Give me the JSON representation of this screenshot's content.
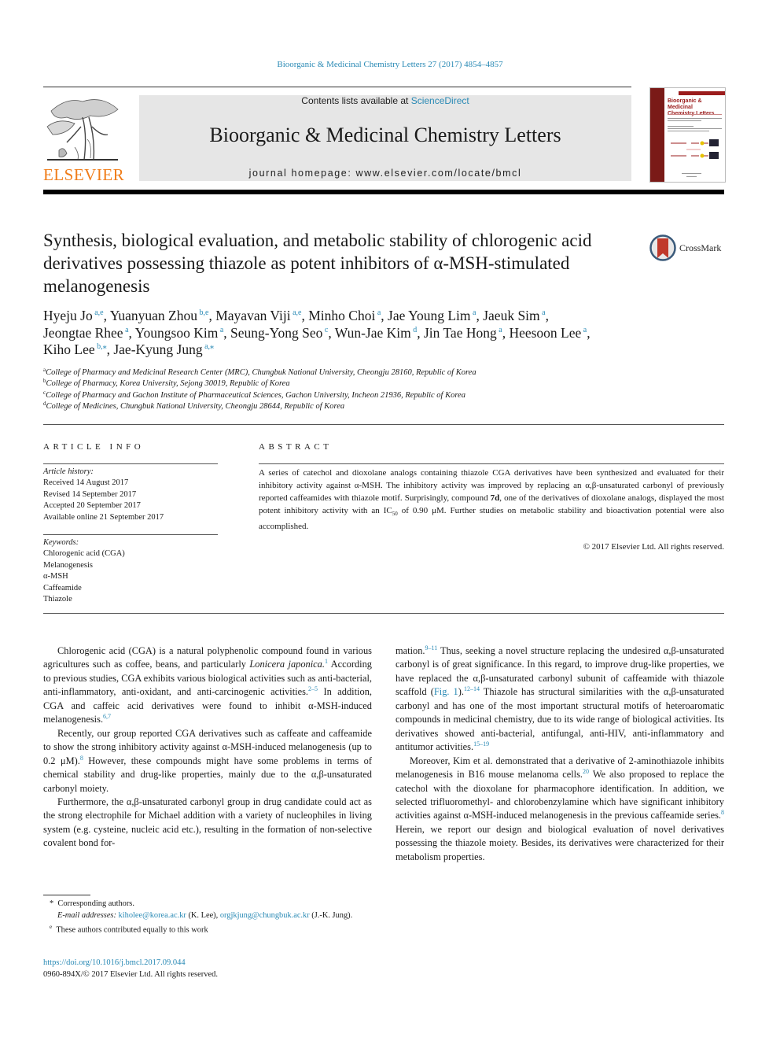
{
  "header": {
    "journal_reference": "Bioorganic & Medicinal Chemistry Letters 27 (2017) 4854–4857",
    "contents_prefix": "Contents lists available at ",
    "contents_link": "ScienceDirect",
    "journal_title": "Bioorganic & Medicinal Chemistry Letters",
    "homepage": "journal homepage: www.elsevier.com/locate/bmcl",
    "publisher_logo_text": "ELSEVIER",
    "cover_title_line1": "Bioorganic & Medicinal",
    "cover_title_line2": "Chemistry Letters",
    "crossmark_label": "CrossMark"
  },
  "article": {
    "title": "Synthesis, biological evaluation, and metabolic stability of chlorogenic acid derivatives possessing thiazole as potent inhibitors of α-MSH-stimulated melanogenesis",
    "authors": [
      {
        "name": "Hyeju Jo",
        "aff": "a,e"
      },
      {
        "name": "Yuanyuan Zhou",
        "aff": "b,e"
      },
      {
        "name": "Mayavan Viji",
        "aff": "a,e"
      },
      {
        "name": "Minho Choi",
        "aff": "a"
      },
      {
        "name": "Jae Young Lim",
        "aff": "a"
      },
      {
        "name": "Jaeuk Sim",
        "aff": "a"
      },
      {
        "name": "Jeongtae Rhee",
        "aff": "a"
      },
      {
        "name": "Youngsoo Kim",
        "aff": "a"
      },
      {
        "name": "Seung-Yong Seo",
        "aff": "c"
      },
      {
        "name": "Wun-Jae Kim",
        "aff": "d"
      },
      {
        "name": "Jin Tae Hong",
        "aff": "a"
      },
      {
        "name": "Heesoon Lee",
        "aff": "a"
      },
      {
        "name": "Kiho Lee",
        "aff": "b,*"
      },
      {
        "name": "Jae-Kyung Jung",
        "aff": "a,*"
      }
    ],
    "affiliations": [
      {
        "key": "a",
        "text": "College of Pharmacy and Medicinal Research Center (MRC), Chungbuk National University, Cheongju 28160, Republic of Korea"
      },
      {
        "key": "b",
        "text": "College of Pharmacy, Korea University, Sejong 30019, Republic of Korea"
      },
      {
        "key": "c",
        "text": "College of Pharmacy and Gachon Institute of Pharmaceutical Sciences, Gachon University, Incheon 21936, Republic of Korea"
      },
      {
        "key": "d",
        "text": "College of Medicines, Chungbuk National University, Cheongju 28644, Republic of Korea"
      }
    ]
  },
  "article_info": {
    "heading": "ARTICLE INFO",
    "history_label": "Article history:",
    "history": [
      "Received 14 August 2017",
      "Revised 14 September 2017",
      "Accepted 20 September 2017",
      "Available online 21 September 2017"
    ],
    "keywords_label": "Keywords:",
    "keywords": [
      "Chlorogenic acid (CGA)",
      "Melanogenesis",
      "α-MSH",
      "Caffeamide",
      "Thiazole"
    ]
  },
  "abstract": {
    "heading": "ABSTRACT",
    "part1": "A series of catechol and dioxolane analogs containing thiazole CGA derivatives have been synthesized and evaluated for their inhibitory activity against α-MSH. The inhibitory activity was improved by replacing an α,β-unsaturated carbonyl of previously reported caffeamides with thiazole motif. Surprisingly, compound ",
    "compound": "7d",
    "part2": ", one of the derivatives of dioxolane analogs, displayed the most potent inhibitory activity with an IC",
    "ic_sub": "50",
    "part3": " of 0.90 μM. Further studies on metabolic stability and bioactivation potential were also accomplished.",
    "copyright": "© 2017 Elsevier Ltd. All rights reserved."
  },
  "body": {
    "p1": {
      "t1": "Chlorogenic acid (CGA) is a natural polyphenolic compound found in various agricultures such as coffee, beans, and particularly ",
      "italic": "Lonicera japonica.",
      "r1": "1",
      "t2": " According to previous studies, CGA exhibits various biological activities such as anti-bacterial, anti-inflammatory, anti-oxidant, and anti-carcinogenic activities.",
      "r2": "2–5",
      "t3": " In addition, CGA and caffeic acid derivatives were found to inhibit α-MSH-induced melanogenesis.",
      "r3": "6,7"
    },
    "p2": {
      "t1": "Recently, our group reported CGA derivatives such as caffeate and caffeamide to show the strong inhibitory activity against α-MSH-induced melanogenesis (up to 0.2 μM).",
      "r1": "8",
      "t2": " However, these compounds might have some problems in terms of chemical stability and drug-like properties, mainly due to the α,β-unsaturated carbonyl moiety."
    },
    "p3": {
      "t1": "Furthermore, the α,β-unsaturated carbonyl group in drug candidate could act as the strong electrophile for Michael addition with a variety of nucleophiles in living system (e.g. cysteine, nucleic acid etc.), resulting in the formation of non-selective covalent bond formation.",
      "r1": "9–11",
      "t2": " Thus, seeking a novel structure replacing the undesired α,β-unsaturated carbonyl is of great significance. In this regard, to improve drug-like properties, we have replaced the α,β-unsaturated carbonyl subunit of caffeamide with thiazole scaffold (",
      "fig_link": "Fig. 1",
      "t3": ").",
      "r2": "12–14",
      "t4": " Thiazole has structural similarities with the α,β-unsaturated carbonyl and has one of the most important structural motifs of heteroaromatic compounds in medicinal chemistry, due to its wide range of biological activities. Its derivatives showed anti-bacterial, antifungal, anti-HIV, anti-inflammatory and antitumor activities.",
      "r3": "15–19"
    },
    "p4": {
      "t1": "Moreover, Kim et al. demonstrated that a derivative of 2-aminothiazole inhibits melanogenesis in B16 mouse melanoma cells.",
      "r1": "20",
      "t2": " We also proposed to replace the catechol with the dioxolane for pharmacophore identification. In addition, we selected trifluoromethyl- and chlorobenzylamine which have significant inhibitory activities against α-MSH-induced melanogenesis in the previous caffeamide series.",
      "r2": "8",
      "t3": " Herein, we report our design and biological evaluation of novel derivatives possessing the thiazole moiety. Besides, its derivatives were characterized for their metabolism properties."
    }
  },
  "footnotes": {
    "corresponding_mark": "*",
    "corresponding": "Corresponding authors.",
    "email_label": "E-mail addresses:",
    "email1": "kiholee@korea.ac.kr",
    "email1_owner": " (K. Lee), ",
    "email2": "orgjkjung@chungbuk.ac.kr",
    "email2_owner": " (J.-K. Jung).",
    "equal_mark": "e",
    "equal": "These authors contributed equally to this work",
    "doi": "https://doi.org/10.1016/j.bmcl.2017.09.044",
    "issn": "0960-894X/© 2017 Elsevier Ltd. All rights reserved."
  },
  "colors": {
    "link": "#2a8ab5",
    "elsevier_orange": "#f07d1a",
    "header_box": "#e6e6e6",
    "cover_red": "#7a1a17"
  }
}
